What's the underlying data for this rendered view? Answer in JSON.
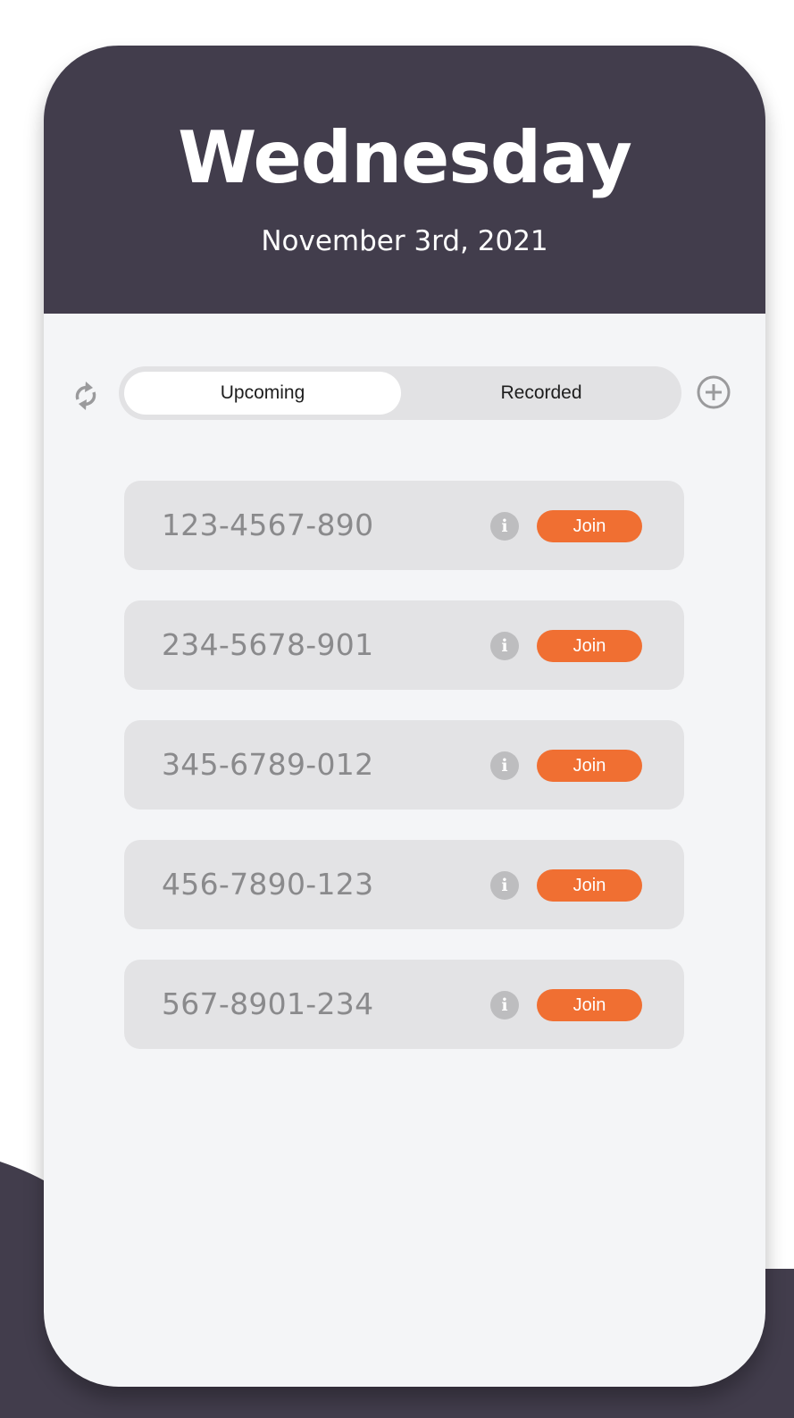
{
  "header": {
    "day": "Wednesday",
    "date": "November 3rd, 2021"
  },
  "tabs": [
    {
      "label": "Upcoming",
      "active": true
    },
    {
      "label": "Recorded",
      "active": false
    }
  ],
  "meetings": [
    {
      "id": "123-4567-890",
      "join_label": "Join"
    },
    {
      "id": "234-5678-901",
      "join_label": "Join"
    },
    {
      "id": "345-6789-012",
      "join_label": "Join"
    },
    {
      "id": "456-7890-123",
      "join_label": "Join"
    },
    {
      "id": "567-8901-234",
      "join_label": "Join"
    }
  ],
  "icons": {
    "refresh": "refresh-icon",
    "add": "plus-circle-icon",
    "info": "info-icon",
    "info_glyph": "i"
  },
  "colors": {
    "header_bg": "#423d4c",
    "accent": "#f06f32",
    "card_bg": "#f4f5f7",
    "row_bg": "#e3e3e5"
  }
}
